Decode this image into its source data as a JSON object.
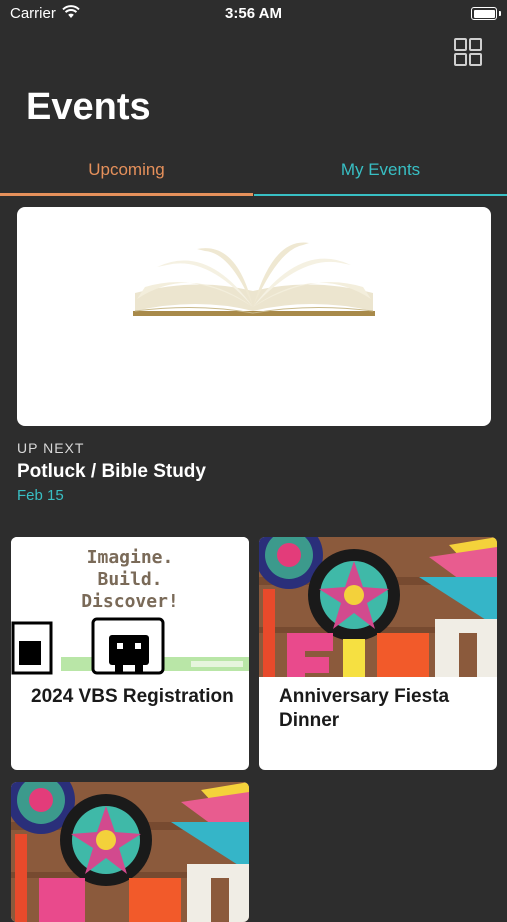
{
  "status_bar": {
    "carrier": "Carrier",
    "time": "3:56 AM"
  },
  "page": {
    "title": "Events"
  },
  "tabs": [
    {
      "label": "Upcoming",
      "active": true
    },
    {
      "label": "My Events",
      "active": false
    }
  ],
  "up_next": {
    "label": "UP NEXT",
    "title": "Potluck / Bible Study",
    "date": "Feb 15",
    "image": "open-book-image"
  },
  "events": [
    {
      "title": "2024 VBS Registration",
      "image": "vbs-imagine-build-discover-image",
      "image_text": [
        "Imagine.",
        "Build.",
        "Discover!"
      ]
    },
    {
      "title": "Anniversary Fiesta Dinner",
      "image": "fiesta-decorations-image"
    },
    {
      "title": "",
      "image": "fiesta-decorations-image"
    }
  ],
  "colors": {
    "background": "#2d2d2d",
    "upcoming_accent": "#e5905b",
    "my_events_accent": "#38bfc4",
    "date_text": "#38bfc4"
  },
  "icons": {
    "grid_toggle": "grid-view-icon",
    "wifi": "wifi-icon",
    "battery": "battery-icon"
  }
}
